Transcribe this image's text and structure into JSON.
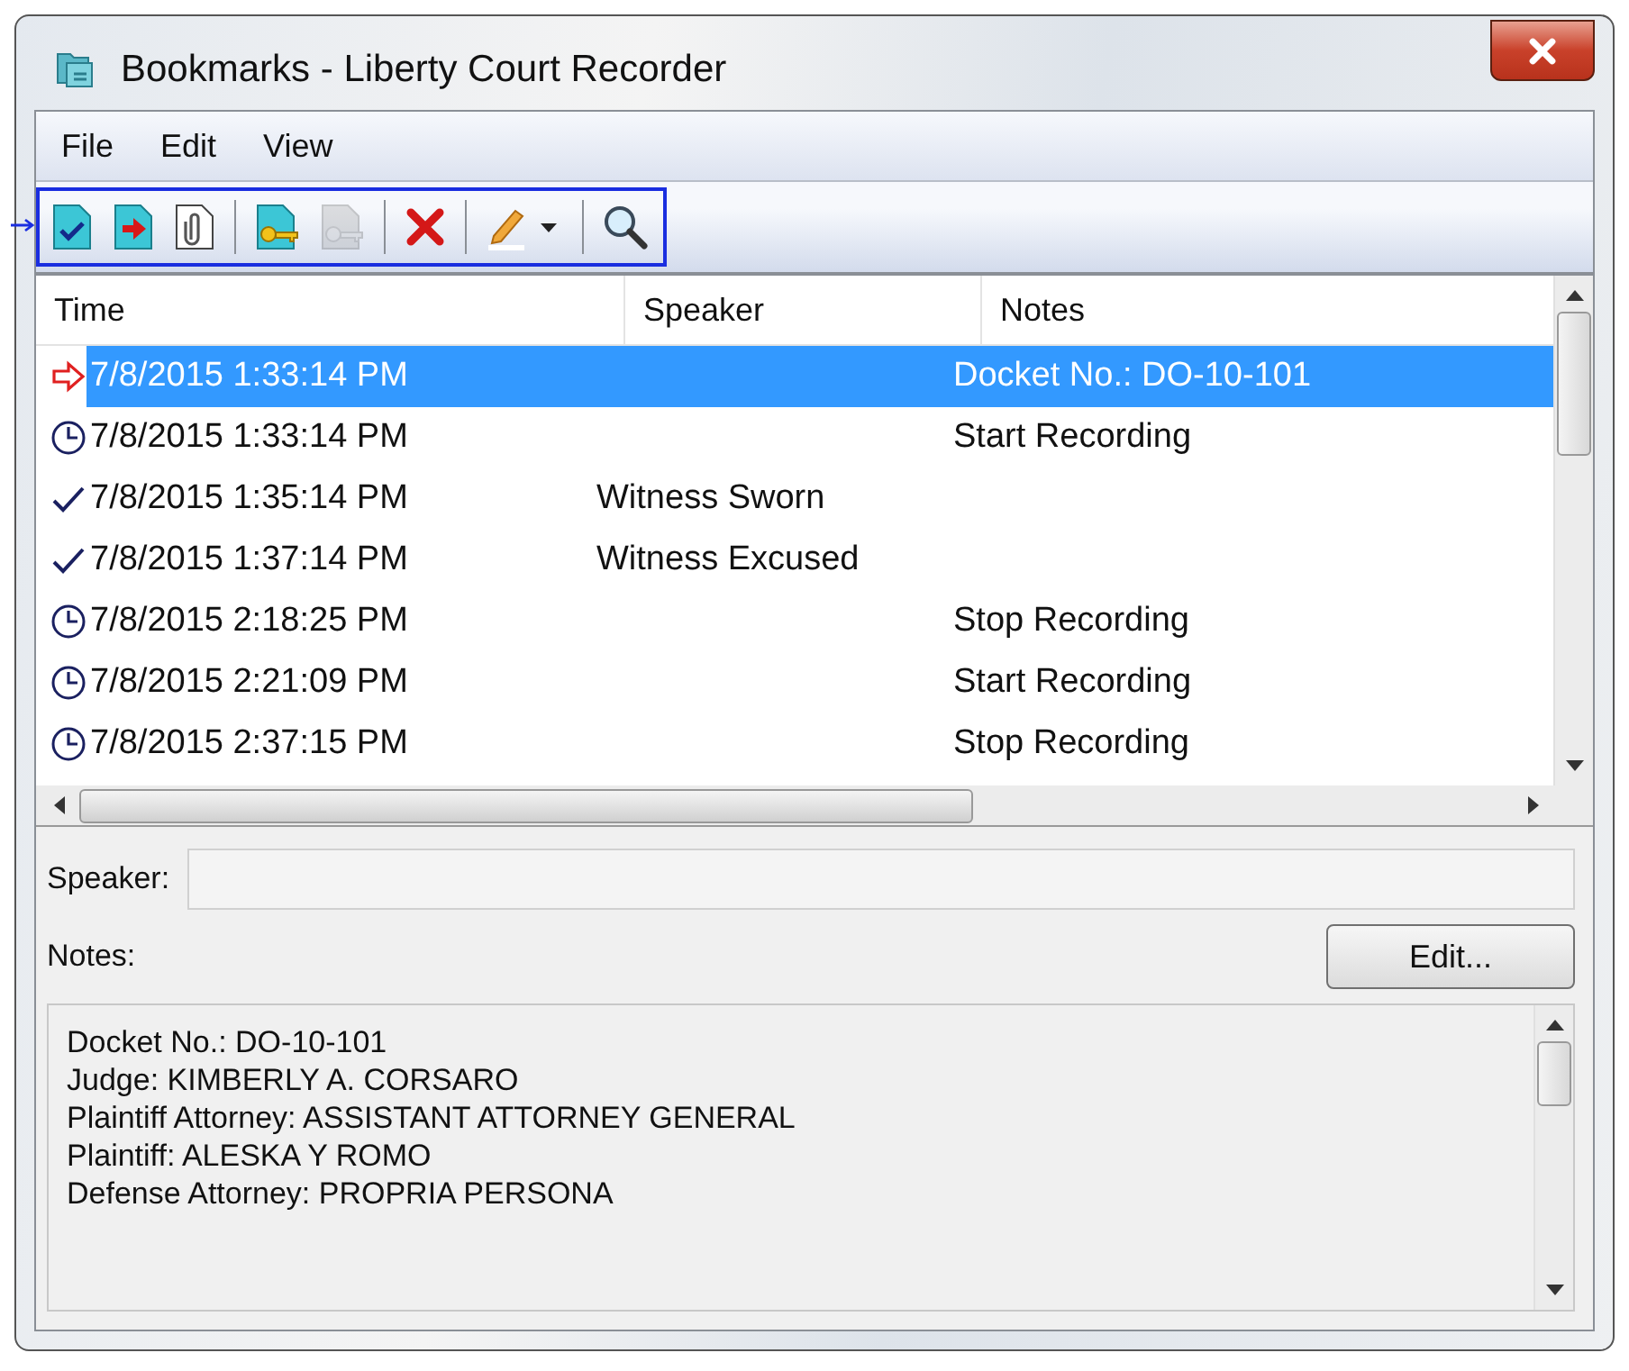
{
  "window": {
    "title": "Bookmarks - Liberty Court Recorder"
  },
  "menu": [
    {
      "label": "File"
    },
    {
      "label": "Edit"
    },
    {
      "label": "View"
    }
  ],
  "toolbar": {
    "highlighted": true,
    "items": [
      {
        "kind": "check-page",
        "disabled": false
      },
      {
        "kind": "arrow-page",
        "disabled": false
      },
      {
        "kind": "clip-page",
        "disabled": false
      },
      {
        "kind": "separator"
      },
      {
        "kind": "key-page",
        "disabled": false
      },
      {
        "kind": "key-page",
        "disabled": true
      },
      {
        "kind": "separator"
      },
      {
        "kind": "delete",
        "disabled": false
      },
      {
        "kind": "separator"
      },
      {
        "kind": "pencil-dropdown",
        "disabled": false
      },
      {
        "kind": "separator"
      },
      {
        "kind": "search",
        "disabled": false
      }
    ]
  },
  "table": {
    "columns": [
      "Time",
      "Speaker",
      "Notes"
    ],
    "rows": [
      {
        "kind": "current",
        "selected": true,
        "time": "7/8/2015 1:33:14 PM",
        "notes": "Docket No.: DO-10-101"
      },
      {
        "kind": "clock",
        "selected": false,
        "time": "7/8/2015 1:33:14 PM",
        "notes": "Start Recording"
      },
      {
        "kind": "check",
        "selected": false,
        "time": "7/8/2015 1:35:14 PM",
        "speaker": "Witness Sworn"
      },
      {
        "kind": "check",
        "selected": false,
        "time": "7/8/2015 1:37:14 PM",
        "speaker": "Witness Excused"
      },
      {
        "kind": "clock",
        "selected": false,
        "time": "7/8/2015 2:18:25 PM",
        "notes": "Stop Recording"
      },
      {
        "kind": "clock",
        "selected": false,
        "time": "7/8/2015 2:21:09 PM",
        "notes": "Start Recording"
      },
      {
        "kind": "clock",
        "selected": false,
        "time": "7/8/2015 2:37:15 PM",
        "notes": "Stop Recording"
      }
    ]
  },
  "details": {
    "speaker_label": "Speaker:",
    "notes_label": "Notes:",
    "edit_button": "Edit...",
    "notes_lines": [
      "Docket No.: DO-10-101",
      "Judge: KIMBERLY A. CORSARO",
      "Plaintiff Attorney: ASSISTANT ATTORNEY GENERAL",
      "Plaintiff: ALESKA Y ROMO",
      "Defense Attorney: PROPRIA PERSONA"
    ]
  }
}
